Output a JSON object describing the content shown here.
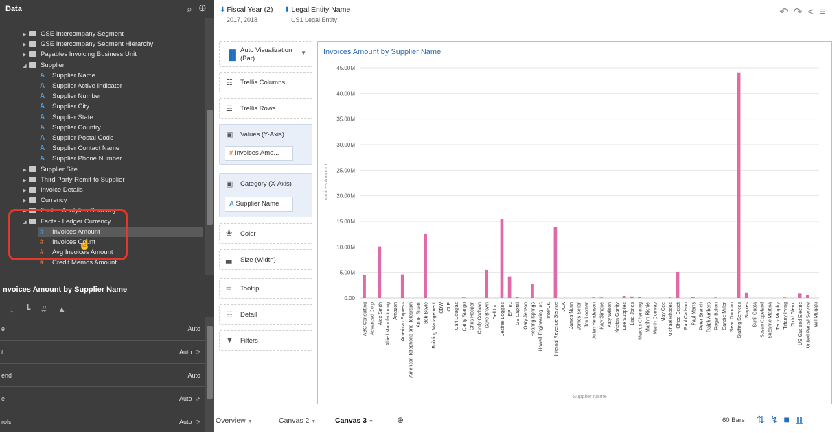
{
  "data_panel": {
    "title": "Data",
    "items": [
      {
        "kind": "folder",
        "indent": 1,
        "toggle": "▶",
        "label": "GSE Intercompany Segment"
      },
      {
        "kind": "folder",
        "indent": 1,
        "toggle": "▶",
        "label": "GSE Intercompany Segment Hierarchy"
      },
      {
        "kind": "folder",
        "indent": 1,
        "toggle": "▶",
        "label": "Payables Invoicing Business Unit"
      },
      {
        "kind": "folder",
        "indent": 1,
        "toggle": "◢",
        "label": "Supplier"
      },
      {
        "kind": "attr",
        "indent": 2,
        "label": "Supplier Name"
      },
      {
        "kind": "attr",
        "indent": 2,
        "label": "Supplier Active Indicator"
      },
      {
        "kind": "attr",
        "indent": 2,
        "label": "Supplier Number"
      },
      {
        "kind": "attr",
        "indent": 2,
        "label": "Supplier City"
      },
      {
        "kind": "attr",
        "indent": 2,
        "label": "Supplier State"
      },
      {
        "kind": "attr",
        "indent": 2,
        "label": "Supplier Country"
      },
      {
        "kind": "attr",
        "indent": 2,
        "label": "Supplier Postal Code"
      },
      {
        "kind": "attr",
        "indent": 2,
        "label": "Supplier Contact Name"
      },
      {
        "kind": "attr",
        "indent": 2,
        "label": "Supplier Phone Number"
      },
      {
        "kind": "folder",
        "indent": 1,
        "toggle": "▶",
        "label": "Supplier Site"
      },
      {
        "kind": "folder",
        "indent": 1,
        "toggle": "▶",
        "label": "Third Party Remit-to Supplier"
      },
      {
        "kind": "folder",
        "indent": 1,
        "toggle": "▶",
        "label": "Invoice Details"
      },
      {
        "kind": "folder",
        "indent": 1,
        "toggle": "▶",
        "label": "Currency"
      },
      {
        "kind": "folder",
        "indent": 1,
        "toggle": "▶",
        "label": "Facts - Analytics Currency"
      },
      {
        "kind": "folder",
        "indent": 1,
        "toggle": "◢",
        "label": "Facts - Ledger Currency"
      },
      {
        "kind": "measure",
        "indent": 2,
        "label": "Invoices Amount",
        "highlight": true
      },
      {
        "kind": "measure",
        "indent": 2,
        "label": "Invoices Count"
      },
      {
        "kind": "measure",
        "indent": 2,
        "label": "Avg Invoices Amount"
      },
      {
        "kind": "measure",
        "indent": 2,
        "label": "Credit Memos Amount"
      }
    ]
  },
  "properties": {
    "title": "nvoices Amount by Supplier Name",
    "rows": [
      {
        "label": "e",
        "value": "Auto",
        "icon": ""
      },
      {
        "label": "t",
        "value": "Auto",
        "icon": "⟳"
      },
      {
        "label": "end",
        "value": "Auto",
        "icon": ""
      },
      {
        "label": "e",
        "value": "Auto",
        "icon": "⟳"
      },
      {
        "label": "rols",
        "value": "Auto",
        "icon": "⟳"
      }
    ]
  },
  "filters": [
    {
      "name": "Fiscal Year (2)",
      "value": "2017, 2018"
    },
    {
      "name": "Legal Entity Name",
      "value": "US1 Legal Entity"
    }
  ],
  "grammar": {
    "viz_type": "Auto Visualization",
    "viz_sub": "(Bar)",
    "trellis_columns": "Trellis Columns",
    "trellis_rows": "Trellis Rows",
    "values_label": "Values (Y-Axis)",
    "values_pill": "Invoices Amo...",
    "category_label": "Category (X-Axis)",
    "category_pill": "Supplier Name",
    "color": "Color",
    "size": "Size (Width)",
    "tooltip": "Tooltip",
    "detail": "Detail",
    "filters": "Filters"
  },
  "bottom": {
    "tabs": [
      "Overview",
      "Canvas 2",
      "Canvas 3"
    ],
    "active": 2,
    "bars_count": "60 Bars"
  },
  "chart_data": {
    "type": "bar",
    "title": "Invoices Amount by Supplier Name",
    "xlabel": "Supplier Name",
    "ylabel": "Invoices Amount",
    "ylim": [
      0,
      45000000
    ],
    "yticks": [
      "0.00",
      "5.00M",
      "10.00M",
      "15.00M",
      "20.00M",
      "25.00M",
      "30.00M",
      "35.00M",
      "40.00M",
      "45.00M"
    ],
    "color": "#e06aa9",
    "grid": true,
    "categories": [
      "ABC Consulting",
      "Advanced Corp",
      "Alex Smith",
      "Allied Manufacturing",
      "Amazon",
      "American Express",
      "American Telephone and Telegraph",
      "Anne Stuart",
      "Bob Boyle",
      "Building Management",
      "CDW",
      "CLP",
      "Carl Douglas",
      "Cathy Stango",
      "Chris Hooper",
      "Cindy Cochran",
      "Dave Brown",
      "Dell Inc.",
      "Desiree Loggins",
      "EP Inc",
      "GE Capital",
      "Gary Jenson",
      "Hearing Springs",
      "Howell Engineering Inc",
      "InterUK",
      "Internal Revenue Service",
      "JOA",
      "James Nunn",
      "James Seller",
      "Jon Loomer",
      "Julian Henderson",
      "Katy Simone",
      "Katy Wilson",
      "Kristen Garrity",
      "Lee Supplies",
      "Lisa Jones",
      "Marcus Channing",
      "Marilyn Richie",
      "Martin Conway",
      "May Gee",
      "Michael Rhodes",
      "Office Depot",
      "Paul Carlson",
      "Paul Marrs",
      "Peter Branch",
      "Ralph Ambers",
      "Roger Bolton",
      "Sandie Miller",
      "Sean Goodan",
      "Staffing Services",
      "Staples",
      "Sunil Gupta",
      "Susan Copeland",
      "Suzanne Martina",
      "Terry Murphy",
      "Tiffany Irving",
      "Todd Glenk",
      "US Gas and Electric",
      "United Parcel Service",
      "Will Mugatu"
    ],
    "values": [
      4500000,
      0,
      10100000,
      0,
      0,
      4600000,
      0,
      0,
      12600000,
      0,
      0,
      0,
      0,
      100000,
      0,
      0,
      5500000,
      0,
      15500000,
      4200000,
      200000,
      0,
      2700000,
      0,
      0,
      13900000,
      0,
      0,
      0,
      0,
      100000,
      100000,
      0,
      0,
      400000,
      300000,
      200000,
      0,
      0,
      0,
      100000,
      5100000,
      0,
      200000,
      0,
      0,
      100000,
      0,
      0,
      44100000,
      1100000,
      0,
      0,
      0,
      0,
      100000,
      0,
      900000,
      600000,
      0
    ]
  }
}
